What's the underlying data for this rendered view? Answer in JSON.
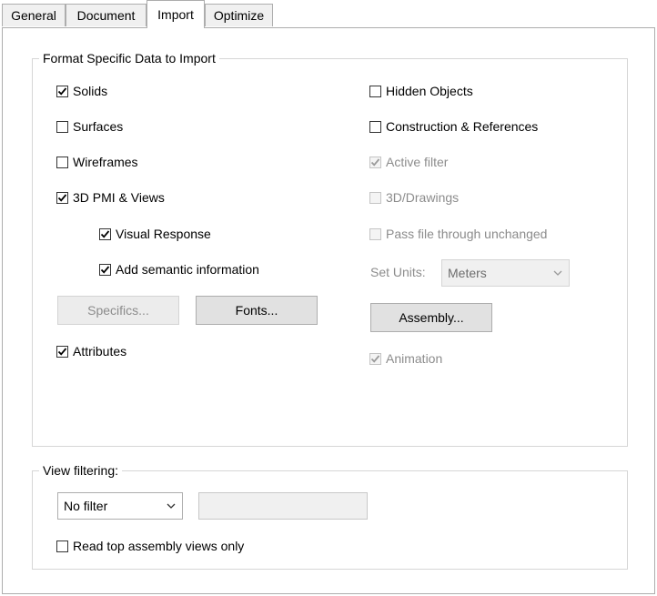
{
  "tabs": [
    {
      "label": "General"
    },
    {
      "label": "Document"
    },
    {
      "label": "Import"
    },
    {
      "label": "Optimize"
    }
  ],
  "format_group": {
    "title": "Format Specific Data to Import",
    "left": {
      "solids": {
        "label": "Solids",
        "checked": true
      },
      "surfaces": {
        "label": "Surfaces",
        "checked": false
      },
      "wireframes": {
        "label": "Wireframes",
        "checked": false
      },
      "pmi_views": {
        "label": "3D PMI & Views",
        "checked": true
      },
      "visual_response": {
        "label": "Visual Response",
        "checked": true
      },
      "semantic_info": {
        "label": "Add semantic information",
        "checked": true
      },
      "specifics_button": "Specifics...",
      "fonts_button": "Fonts...",
      "attributes": {
        "label": "Attributes",
        "checked": true
      }
    },
    "right": {
      "hidden_objects": {
        "label": "Hidden Objects",
        "checked": false
      },
      "construction_refs": {
        "label": "Construction & References",
        "checked": false
      },
      "active_filter": {
        "label": "Active filter",
        "checked": true
      },
      "drawings_3d": {
        "label": "3D/Drawings",
        "checked": false
      },
      "pass_through": {
        "label": "Pass file through unchanged",
        "checked": false
      },
      "set_units_label": "Set Units:",
      "set_units_value": "Meters",
      "assembly_button": "Assembly...",
      "animation": {
        "label": "Animation",
        "checked": true
      }
    }
  },
  "view_group": {
    "title": "View filtering:",
    "filter_value": "No filter",
    "text_value": "",
    "read_top": {
      "label": "Read top assembly views only",
      "checked": false
    }
  }
}
